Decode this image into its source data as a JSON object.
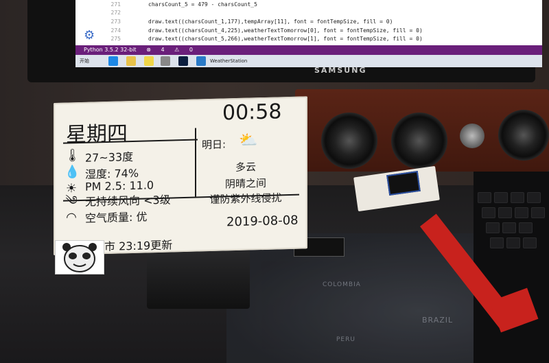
{
  "monitor": {
    "code_lines": [
      {
        "num": "271",
        "text": "charsCount_5 = 479 - charsCount_5"
      },
      {
        "num": "272",
        "text": ""
      },
      {
        "num": "273",
        "text": "draw.text((charsCount_1,177),tempArray[11], font = fontTempSize, fill = 0)"
      },
      {
        "num": "274",
        "text": "draw.text((charsCount_4,225),weatherTextTomorrow[0], font = fontTempSize, fill = 0)"
      },
      {
        "num": "275",
        "text": "draw.text((charsCount_5,266),weatherTextTomorrow[1], font = fontTempSize, fill = 0)"
      }
    ],
    "status_interpreter": "Python 3.5.2 32-bit",
    "status_errors": "4",
    "status_warnings": "0",
    "taskbar_start": "开始",
    "taskbar_app": "WeatherStation",
    "brand": "SAMSUNG"
  },
  "display": {
    "weekday": "星期四",
    "time": "00:58",
    "temperature": "27~33度",
    "humidity": "湿度: 74%",
    "pm25": "PM 2.5: 11.0",
    "wind": "无持续风向 <3级",
    "air_quality": "空气质量: 优",
    "tomorrow_label": "明日:",
    "tomorrow_day": "多云",
    "tomorrow_night": "阴晴之间",
    "tomorrow_advice": "谨防紫外线侵扰",
    "date": "2019-08-08",
    "updated": "市 23:19更新"
  },
  "map_labels": [
    "COLOMBIA",
    "BRAZIL",
    "PERU"
  ],
  "colors": {
    "epaper_bg": "#f4f1e8",
    "ink": "#1a1a1a",
    "status_bar": "#6a1f7a",
    "accent_red": "#c8221d",
    "speaker_wood": "#5a2416"
  }
}
